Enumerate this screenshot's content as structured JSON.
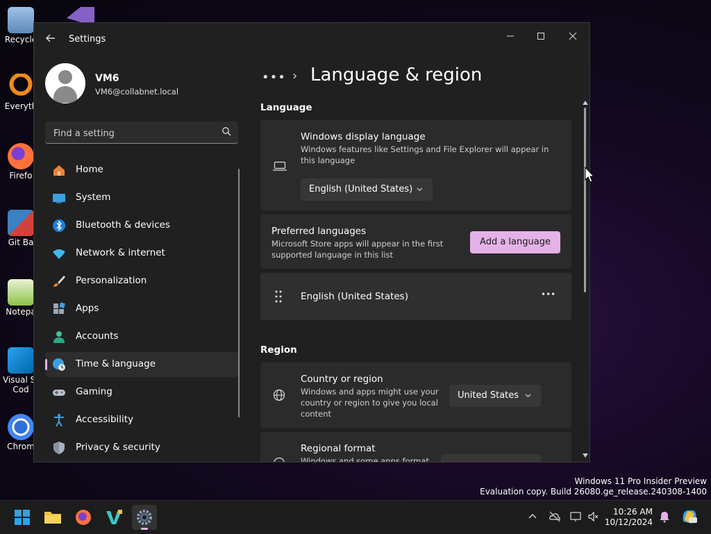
{
  "desktop": {
    "icons": [
      {
        "label": "Recycle",
        "name": "recycle-bin"
      },
      {
        "label": "Everyth",
        "name": "everything"
      },
      {
        "label": "Firefo",
        "name": "firefox"
      },
      {
        "label": "Git Ba",
        "name": "git-bash"
      },
      {
        "label": "Notepa",
        "name": "notepad"
      },
      {
        "label": "Visual St",
        "label2": "Cod",
        "name": "vscode"
      },
      {
        "label": "Chrom",
        "name": "chrome"
      }
    ]
  },
  "window": {
    "title": "Settings",
    "controls": {
      "minimize": "—",
      "maximize": "☐",
      "close": "✕"
    }
  },
  "profile": {
    "name": "VM6",
    "email": "VM6@collabnet.local"
  },
  "search": {
    "placeholder": "Find a setting"
  },
  "nav": {
    "items": [
      {
        "label": "Home",
        "icon": "home-icon"
      },
      {
        "label": "System",
        "icon": "system-icon"
      },
      {
        "label": "Bluetooth & devices",
        "icon": "bluetooth-icon"
      },
      {
        "label": "Network & internet",
        "icon": "network-icon"
      },
      {
        "label": "Personalization",
        "icon": "brush-icon"
      },
      {
        "label": "Apps",
        "icon": "apps-icon"
      },
      {
        "label": "Accounts",
        "icon": "accounts-icon"
      },
      {
        "label": "Time & language",
        "icon": "time-language-icon",
        "active": true
      },
      {
        "label": "Gaming",
        "icon": "gamepad-icon"
      },
      {
        "label": "Accessibility",
        "icon": "accessibility-icon"
      },
      {
        "label": "Privacy & security",
        "icon": "shield-icon"
      }
    ]
  },
  "content": {
    "breadcrumb_more": "•••",
    "breadcrumb_sep": "›",
    "title": "Language & region",
    "language_section": "Language",
    "display_language": {
      "title": "Windows display language",
      "desc": "Windows features like Settings and File Explorer will appear in this language",
      "value": "English (United States)"
    },
    "preferred": {
      "title": "Preferred languages",
      "desc": "Microsoft Store apps will appear in the first supported language in this list",
      "button": "Add a language",
      "item": "English (United States)",
      "more": "•••"
    },
    "region_section": "Region",
    "country": {
      "title": "Country or region",
      "desc": "Windows and apps might use your country or region to give you local content",
      "value": "United States"
    },
    "regional_format": {
      "title": "Regional format",
      "desc": "Windows and some apps format"
    }
  },
  "watermark": {
    "line1": "Windows 11 Pro Insider Preview",
    "line2": "Evaluation copy. Build 26080.ge_release.240308-1400"
  },
  "taskbar": {
    "time": "10:26 AM",
    "date": "10/12/2024"
  },
  "colors": {
    "accent": "#e5b2e8",
    "window_bg": "#202020",
    "card_bg": "#2b2b2b"
  }
}
